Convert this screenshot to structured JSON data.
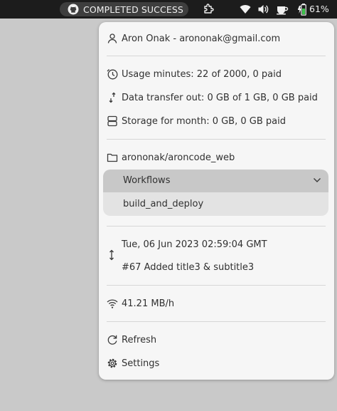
{
  "topbar": {
    "status": "COMPLETED SUCCESS",
    "battery": "61%",
    "icons": [
      "github-icon",
      "extension-icon",
      "wifi-icon",
      "volume-icon",
      "coffee-icon",
      "battery-icon"
    ]
  },
  "menu": {
    "account": "Aron Onak - arononak@gmail.com",
    "usage": {
      "minutes": "Usage minutes: 22 of 2000, 0 paid",
      "transfer": "Data transfer out: 0 GB of 1 GB, 0 GB paid",
      "storage": "Storage for month: 0 GB, 0 GB paid"
    },
    "repository": "arononak/aroncode_web",
    "workflows": {
      "label": "Workflows",
      "items": [
        "build_and_deploy"
      ]
    },
    "last_run": {
      "date": "Tue, 06 Jun 2023 02:59:04 GMT",
      "message": "#67 Added title3 & subtitle3"
    },
    "network_speed": "41.21 MB/h",
    "actions": {
      "refresh": "Refresh",
      "settings": "Settings"
    }
  },
  "colors": {
    "topbar": "#1c1c1c",
    "pill": "#3e3e3e",
    "menu_bg": "#f6f6f6",
    "desktop": "#c9c9c9",
    "workflows_header": "#c8c8c8",
    "workflows_item": "#e3e3e3",
    "battery_green": "#3cc24a"
  }
}
